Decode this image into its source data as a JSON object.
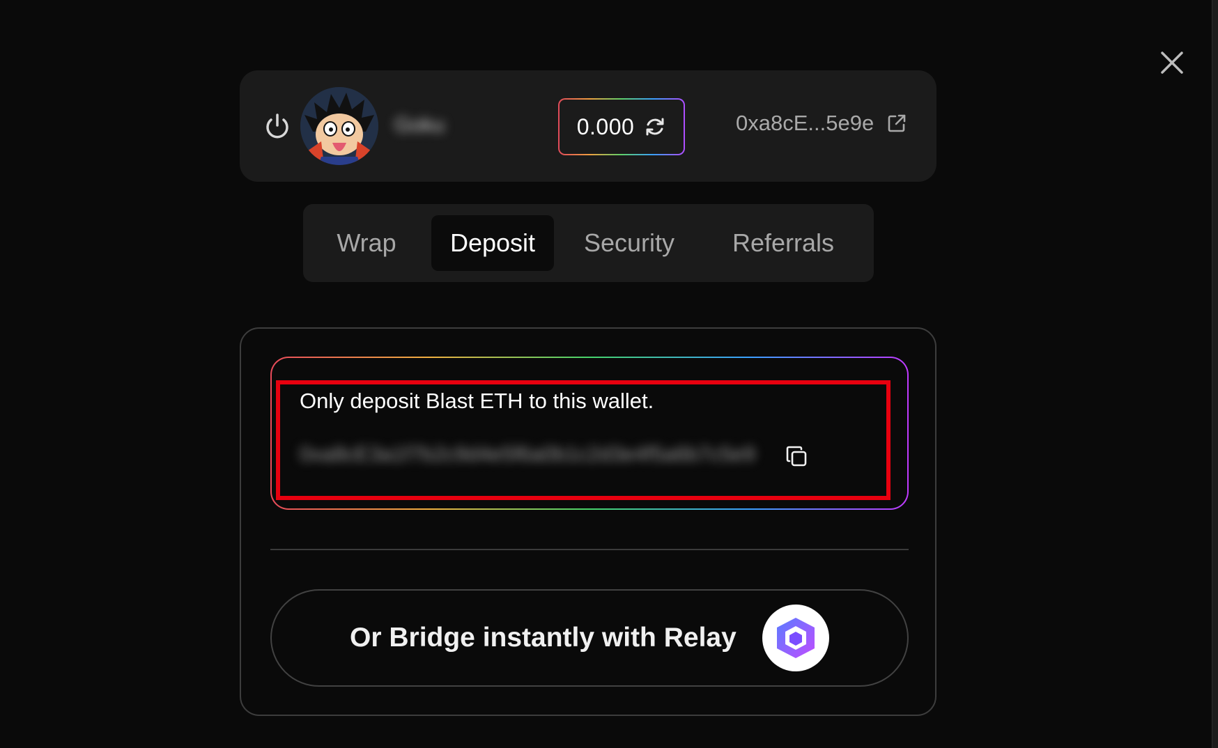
{
  "header": {
    "username": "Goku",
    "balance": "0.000",
    "address_short": "0xa8cE...5e9e"
  },
  "tabs": [
    {
      "label": "Wrap",
      "active": false
    },
    {
      "label": "Deposit",
      "active": true
    },
    {
      "label": "Security",
      "active": false
    },
    {
      "label": "Referrals",
      "active": false
    }
  ],
  "deposit": {
    "note": "Only deposit Blast ETH to this wallet.",
    "wallet_address": "0xa8cE3a1f7b2c9d4e5f6a0b1c2d3e4f5a6b7c5e9e"
  },
  "relay": {
    "label": "Or Bridge instantly with Relay"
  },
  "colors": {
    "background": "#0a0a0a",
    "card": "#1b1b1b",
    "highlight": "#e8000f",
    "relay_purple": "#8a3ffc"
  },
  "icons": [
    "close-icon",
    "power-icon",
    "refresh-icon",
    "external-link-icon",
    "copy-icon",
    "relay-logo"
  ]
}
